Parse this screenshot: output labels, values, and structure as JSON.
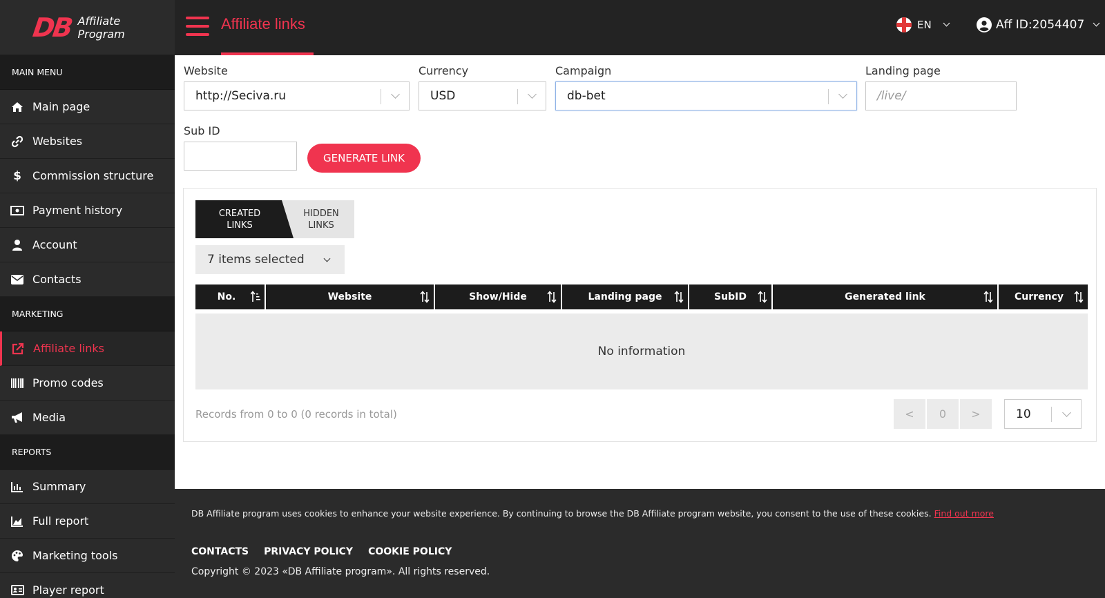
{
  "brand": {
    "logo_mark": "DB",
    "logo_line1": "Affiliate",
    "logo_line2": "Program",
    "accent": "#f0344f"
  },
  "sidebar": {
    "sections": [
      {
        "title": "MAIN MENU",
        "items": [
          {
            "label": "Main page",
            "icon": "home-icon"
          },
          {
            "label": "Websites",
            "icon": "link-icon"
          },
          {
            "label": "Commission structure",
            "icon": "dollar-icon"
          },
          {
            "label": "Payment history",
            "icon": "money-icon"
          },
          {
            "label": "Account",
            "icon": "user-icon"
          },
          {
            "label": "Contacts",
            "icon": "envelope-icon"
          }
        ]
      },
      {
        "title": "MARKETING",
        "items": [
          {
            "label": "Affiliate links",
            "icon": "external-link-icon",
            "active": true
          },
          {
            "label": "Promo codes",
            "icon": "barcode-icon"
          },
          {
            "label": "Media",
            "icon": "megaphone-icon"
          }
        ]
      },
      {
        "title": "REPORTS",
        "items": [
          {
            "label": "Summary",
            "icon": "bar-chart-icon"
          },
          {
            "label": "Full report",
            "icon": "area-chart-icon"
          },
          {
            "label": "Marketing tools",
            "icon": "palette-icon"
          },
          {
            "label": "Player report",
            "icon": "id-card-icon"
          }
        ]
      }
    ]
  },
  "header": {
    "title": "Affiliate links",
    "language": "EN",
    "user": "Aff ID:2054407"
  },
  "form": {
    "website": {
      "label": "Website",
      "value": "http://Seciva.ru"
    },
    "currency": {
      "label": "Currency",
      "value": "USD"
    },
    "campaign": {
      "label": "Campaign",
      "value": "db-bet"
    },
    "landing": {
      "label": "Landing page",
      "placeholder": "/live/"
    },
    "subid": {
      "label": "Sub ID",
      "value": ""
    },
    "generate_label": "GENERATE LINK"
  },
  "tabs": {
    "created_line1": "CREATED",
    "created_line2": "LINKS",
    "hidden_line1": "HIDDEN",
    "hidden_line2": "LINKS"
  },
  "columns_filter": "7 items selected",
  "table": {
    "columns": [
      "No.",
      "Website",
      "Show/Hide",
      "Landing page",
      "SubID",
      "Generated link",
      "Currency"
    ],
    "empty": "No information"
  },
  "pagination": {
    "records": "Records from 0 to 0 (0 records in total)",
    "prev": "<",
    "page": "0",
    "next": ">",
    "per_page": "10"
  },
  "footer": {
    "cookie_text": "DB Affiliate program uses cookies to enhance your website experience. By continuing to browse the DB Affiliate program website, you consent to the use of these cookies.",
    "cookie_link": "Find out more",
    "links": [
      "CONTACTS",
      "PRIVACY POLICY",
      "COOKIE POLICY"
    ],
    "copyright": "Copyright © 2023 «DB Affiliate program». All rights reserved."
  }
}
